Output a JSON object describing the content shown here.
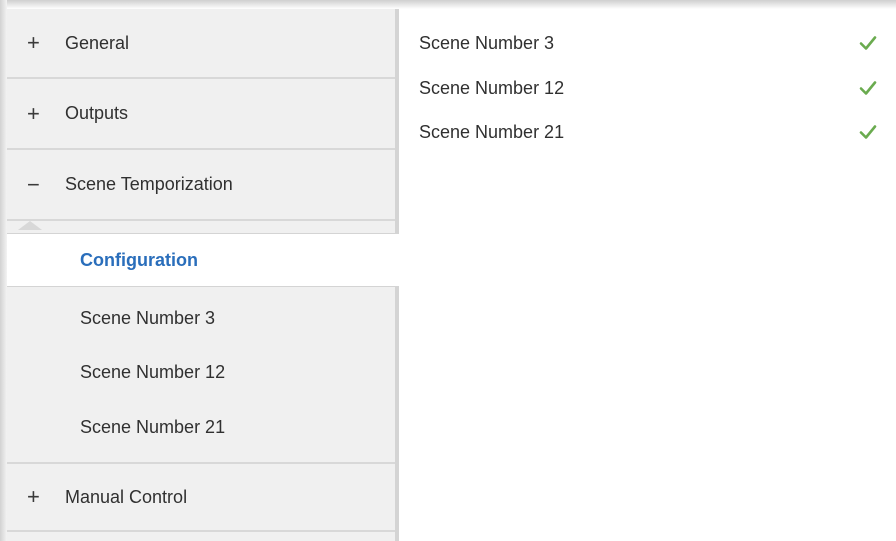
{
  "sidebar": {
    "groups": [
      {
        "sign": "+",
        "label": "General"
      },
      {
        "sign": "+",
        "label": "Outputs"
      },
      {
        "sign": "−",
        "label": "Scene Temporization"
      },
      {
        "sign": "+",
        "label": "Manual Control"
      }
    ],
    "subitems": [
      {
        "label": "Configuration",
        "selected": true
      },
      {
        "label": "Scene Number 3",
        "selected": false
      },
      {
        "label": "Scene Number 12",
        "selected": false
      },
      {
        "label": "Scene Number 21",
        "selected": false
      }
    ]
  },
  "main": {
    "rows": [
      {
        "label": "Scene Number 3",
        "checked": true
      },
      {
        "label": "Scene Number 12",
        "checked": true
      },
      {
        "label": "Scene Number 21",
        "checked": true
      }
    ]
  },
  "colors": {
    "sidebar_bg": "#f0f0f0",
    "selected_text": "#2a6ebb",
    "check_green": "#6aab4f"
  },
  "icons": {
    "expand": "plus-icon",
    "collapse": "minus-icon",
    "check": "checkmark-icon"
  }
}
